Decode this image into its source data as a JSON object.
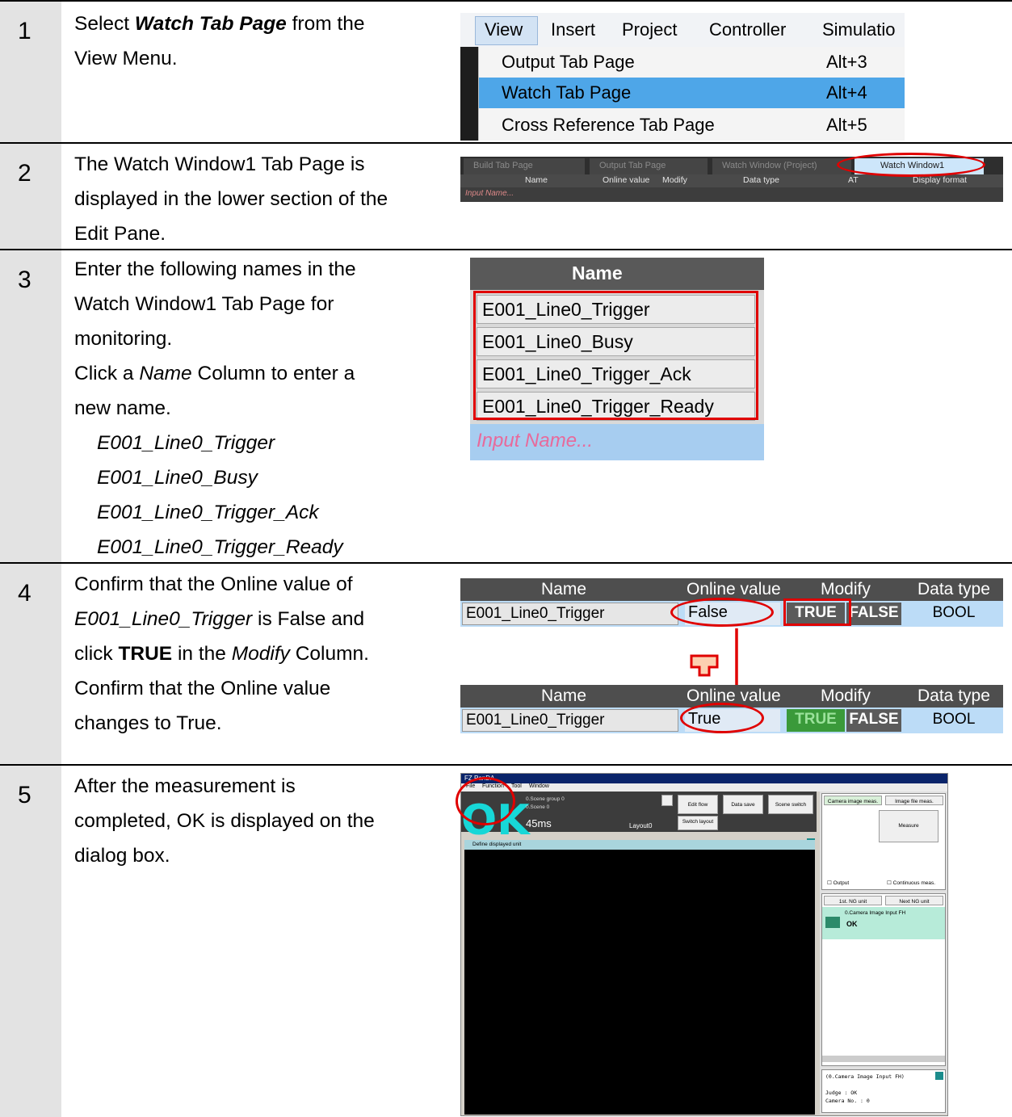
{
  "steps": [
    {
      "num": "1",
      "lines": [
        {
          "pre": "Select ",
          "em": "Watch Tab Page",
          "post": " from the"
        },
        {
          "text": "View Menu."
        }
      ]
    },
    {
      "num": "2",
      "lines": [
        {
          "text": "The Watch Window1 Tab Page is"
        },
        {
          "text": "displayed in the lower section of the"
        },
        {
          "text": "Edit Pane."
        }
      ]
    },
    {
      "num": "3",
      "lines": [
        {
          "text": "Enter the following names in the"
        },
        {
          "text": "Watch Window1 Tab Page for"
        },
        {
          "text": "monitoring."
        },
        {
          "pre": "Click a ",
          "it": "Name",
          "post": " Column to enter a"
        },
        {
          "text": "new name."
        }
      ],
      "names": [
        "E001_Line0_Trigger",
        "E001_Line0_Busy",
        "E001_Line0_Trigger_Ack",
        "E001_Line0_Trigger_Ready"
      ]
    },
    {
      "num": "4",
      "lines": [
        {
          "text": "Confirm that the Online value of"
        },
        {
          "it": "E001_Line0_Trigger",
          "post": " is False and"
        },
        {
          "pre": "click ",
          "b": "TRUE",
          "post": " in the ",
          "it2": "Modify",
          "post2": " Column."
        },
        {
          "text": "Confirm that the Online value"
        },
        {
          "text": "changes to True."
        }
      ]
    },
    {
      "num": "5",
      "lines": [
        {
          "text": "After the measurement is"
        },
        {
          "text": "completed, OK is displayed on the"
        },
        {
          "text": "dialog box."
        }
      ]
    }
  ],
  "menu": {
    "bar": [
      "View",
      "Insert",
      "Project",
      "Controller",
      "Simulatio"
    ],
    "items": [
      {
        "label": "Output Tab Page",
        "key": "Alt+3"
      },
      {
        "label": "Watch Tab Page",
        "key": "Alt+4"
      },
      {
        "label": "Cross Reference Tab Page",
        "key": "Alt+5"
      }
    ]
  },
  "tab_strip": {
    "tabs": [
      "Build Tab Page",
      "Output Tab Page",
      "Watch Window (Project)",
      "Watch Window1"
    ],
    "columns": [
      "Name",
      "Online value",
      "Modify",
      "Data type",
      "AT",
      "Display format"
    ],
    "input_placeholder": "Input Name..."
  },
  "name_list": {
    "header": "Name",
    "input_placeholder": "Input Name..."
  },
  "watch": {
    "headers": [
      "Name",
      "Online value",
      "Modify",
      "Data type"
    ],
    "name": "E001_Line0_Trigger",
    "before_value": "False",
    "after_value": "True",
    "true_label": "TRUE",
    "false_label": "FALSE",
    "type": "BOOL"
  },
  "fz": {
    "title": "FZ PanDA",
    "menu": [
      "File",
      "Function",
      "Tool",
      "Window"
    ],
    "ok": "OK",
    "scene_group": "0.Scene group 0",
    "scene": "0.Scene 0",
    "time": "45ms",
    "layout": "Layout0",
    "buttons": [
      "Edit flow",
      "Data save",
      "Scene switch",
      "Switch layout"
    ],
    "display_bar": "Define displayed unit",
    "tabs": [
      "Camera image meas.",
      "Image file meas."
    ],
    "measure": "Measure",
    "checks": [
      "Output",
      "Continuous meas."
    ],
    "ng_buttons": [
      "1st. NG unit",
      "Next NG unit"
    ],
    "unit_name": "0.Camera Image Input FH",
    "unit_result": "OK",
    "detail_title": "(0.Camera Image Input FH)",
    "detail_lines": [
      "Judge : OK",
      "Camera No. : 0"
    ]
  },
  "colors": {
    "annotation": "#e00000",
    "selected_menu": "#4ea6e8",
    "ok_text": "#17d7d7"
  }
}
